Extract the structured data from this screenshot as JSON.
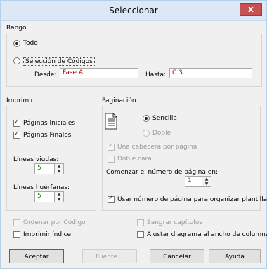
{
  "window": {
    "title": "Seleccionar",
    "close": "x"
  },
  "rango": {
    "label": "Rango",
    "todo": "Todo",
    "seleccion": "Selección de Códigos",
    "desde_label": "Desde:",
    "desde_value": "Fase A",
    "hasta_label": "Hasta:",
    "hasta_value": "C.3."
  },
  "imprimir": {
    "label": "Imprimir",
    "paginas_iniciales": "Páginas Iniciales",
    "paginas_finales": "Páginas Finales",
    "lineas_viudas_label": "Líneas viudas:",
    "lineas_viudas_value": "5",
    "lineas_huerfanas_label": "Líneas huérfanas:",
    "lineas_huerfanas_value": "5"
  },
  "paginacion": {
    "label": "Paginación",
    "sencilla": "Sencilla",
    "doble": "Doble",
    "una_cabecera": "Una cabecera por página",
    "doble_cara": "Doble cara",
    "comenzar_label": "Comenzar el número de página en:",
    "comenzar_value": "1",
    "usar_numero": "Usar número de página para organizar plantilla"
  },
  "options": {
    "ordenar": "Ordenar por Código",
    "imprimir_indice": "Imprimir índice",
    "sangrar": "Sangrar capítulos",
    "ajustar": "Ajustar diagrama al ancho de columna"
  },
  "buttons": {
    "aceptar": "Aceptar",
    "fuente": "Fuente...",
    "cancelar": "Cancelar",
    "ayuda": "Ayuda"
  }
}
